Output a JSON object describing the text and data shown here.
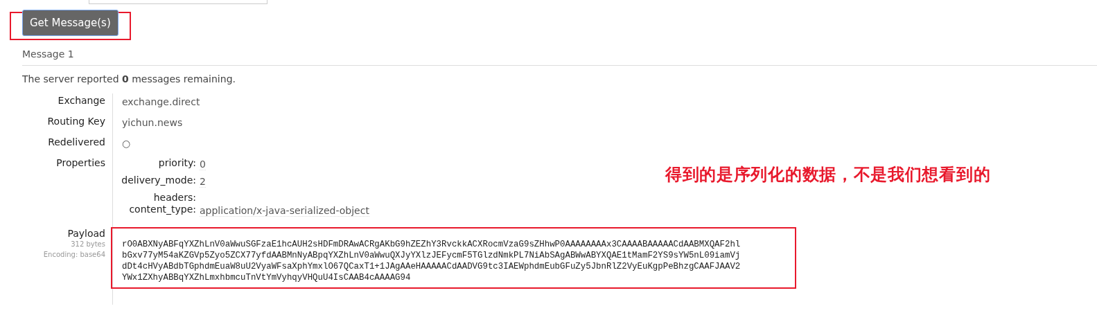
{
  "button": {
    "label": "Get Message(s)"
  },
  "message": {
    "title": "Message 1",
    "summary": "The server reported **0** messages remaining.",
    "fields": [
      {
        "label": "Exchange",
        "value": "exchange.direct"
      },
      {
        "label": "Routing Key",
        "value": "yichun.news"
      },
      {
        "label": "Redelivered",
        "value": "○"
      }
    ],
    "properties_label": "Properties",
    "properties": [
      {
        "key": "priority:",
        "value": "0"
      },
      {
        "key": "delivery_mode:",
        "value": "2"
      },
      {
        "key": "headers:"
      },
      {
        "key": "content_type:",
        "value": "application/x-java-serialized-object"
      }
    ],
    "payload": {
      "label": "Payload",
      "size": "312 bytes",
      "encoding": "Encoding: base64",
      "lines": [
        "rO0ABXNyABFqYXZhLnV0aWwuSGFzaE1hcAUH2sHDFmDRAwACRgAKbG9hZEZhY3RvckkACXRocmVzaG9sZHhwP0AAAAAAAAx3CAAAABAAAAACdAABMXQAF2hl",
        "bGxv77yM54aKZGVp5Zyo5ZCX77yfdAABMnNyABpqYXZhLnV0aWwuQXJyYXlzJEFycmF5TGlzdNmkPL7NiAbSAgABWwABYXQAE1tMamF2YS9sYW5nL09iamVj",
        "dDt4cHVyABdbTGphdmEuaW8uU2VyaWFsaXphYmxlO67QCaxT1+1JAgAAeHAAAAACdAADVG9tc3IAEWphdmEubGFuZy5JbnRlZ2VyEuKgpPeBhzgCAAFJAAV2",
        "YWx1ZXhyABBqYXZhLmxhbmcuTnVtYmVyhqyVHQuU4IsCAAB4cAAAAG94"
      ]
    }
  },
  "annotation": "得到的是序列化的数据，不是我们想看到的"
}
